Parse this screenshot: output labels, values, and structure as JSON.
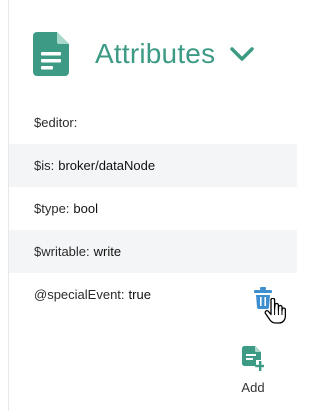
{
  "header": {
    "title": "Attributes",
    "icon": "document-icon",
    "toggle_icon": "chevron-down-icon",
    "accent_color": "#3d9b85"
  },
  "attributes": [
    {
      "key": "$editor:",
      "value": ""
    },
    {
      "key": "$is:",
      "value": "broker/dataNode"
    },
    {
      "key": "$type:",
      "value": "bool"
    },
    {
      "key": "$writable:",
      "value": "write"
    },
    {
      "key": "@specialEvent:",
      "value": "true"
    }
  ],
  "row_actions": {
    "delete_icon": "trash-icon",
    "delete_icon_color": "#3f8fd0"
  },
  "add": {
    "label": "Add",
    "icon": "add-document-icon"
  }
}
